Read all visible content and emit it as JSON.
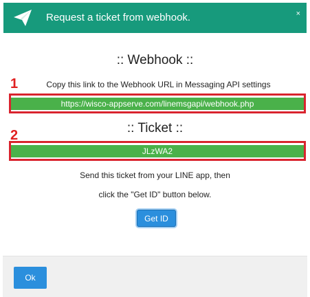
{
  "header": {
    "title": "Request a ticket from webhook.",
    "close": "×",
    "bg_color": "#179a7c",
    "icon": "paper-plane-icon"
  },
  "webhook": {
    "title": ":: Webhook ::",
    "step": "1",
    "hint": "Copy this link to the Webhook URL in Messaging API settings",
    "url": "https://wisco-appserve.com/linemsgapi/webhook.php"
  },
  "ticket": {
    "title": ":: Ticket ::",
    "step": "2",
    "code": "JLzWA2"
  },
  "instructions": {
    "line1": "Send this ticket from your LINE app, then",
    "line2": "click the \"Get ID\" button below."
  },
  "buttons": {
    "get_id": "Get ID",
    "ok": "Ok"
  },
  "colors": {
    "highlight_border": "#d9242e",
    "field_bg": "#4ab14a",
    "button_bg": "#2b8fdd",
    "step_number": "#e02020"
  }
}
